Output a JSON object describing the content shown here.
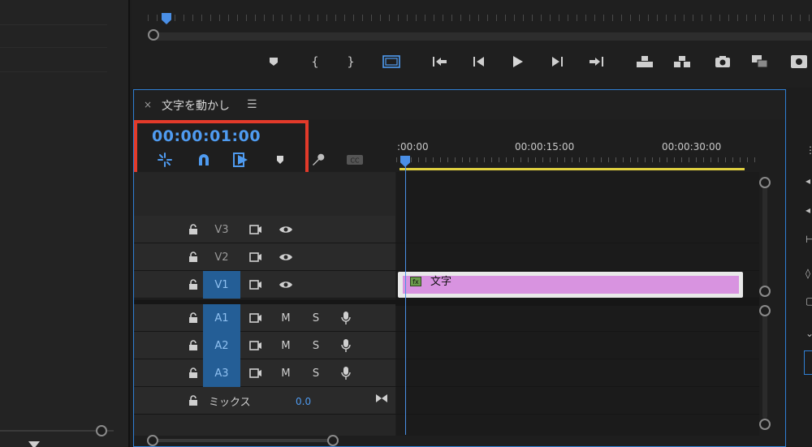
{
  "timeline": {
    "close_glyph": "×",
    "title": "文字を動かし",
    "menu_glyph": "☰",
    "timecode": "00:00:01:00"
  },
  "ruler": {
    "labels": [
      ":00:00",
      "00:00:15:00",
      "00:00:30:00"
    ]
  },
  "tracks": {
    "video": [
      {
        "name": "V3",
        "targeted": false
      },
      {
        "name": "V2",
        "targeted": false
      },
      {
        "name": "V1",
        "targeted": true
      }
    ],
    "audio": [
      {
        "name": "A1",
        "mute": "M",
        "solo": "S"
      },
      {
        "name": "A2",
        "mute": "M",
        "solo": "S"
      },
      {
        "name": "A3",
        "mute": "M",
        "solo": "S"
      }
    ],
    "mix": {
      "label": "ミックス",
      "value": "0.0"
    }
  },
  "clip": {
    "label": "文字",
    "fx_badge": "fx",
    "color": "#d893e0"
  },
  "colors": {
    "accent": "#4f9bf0",
    "highlight": "#e23a2a",
    "work_area": "#e0d040"
  }
}
